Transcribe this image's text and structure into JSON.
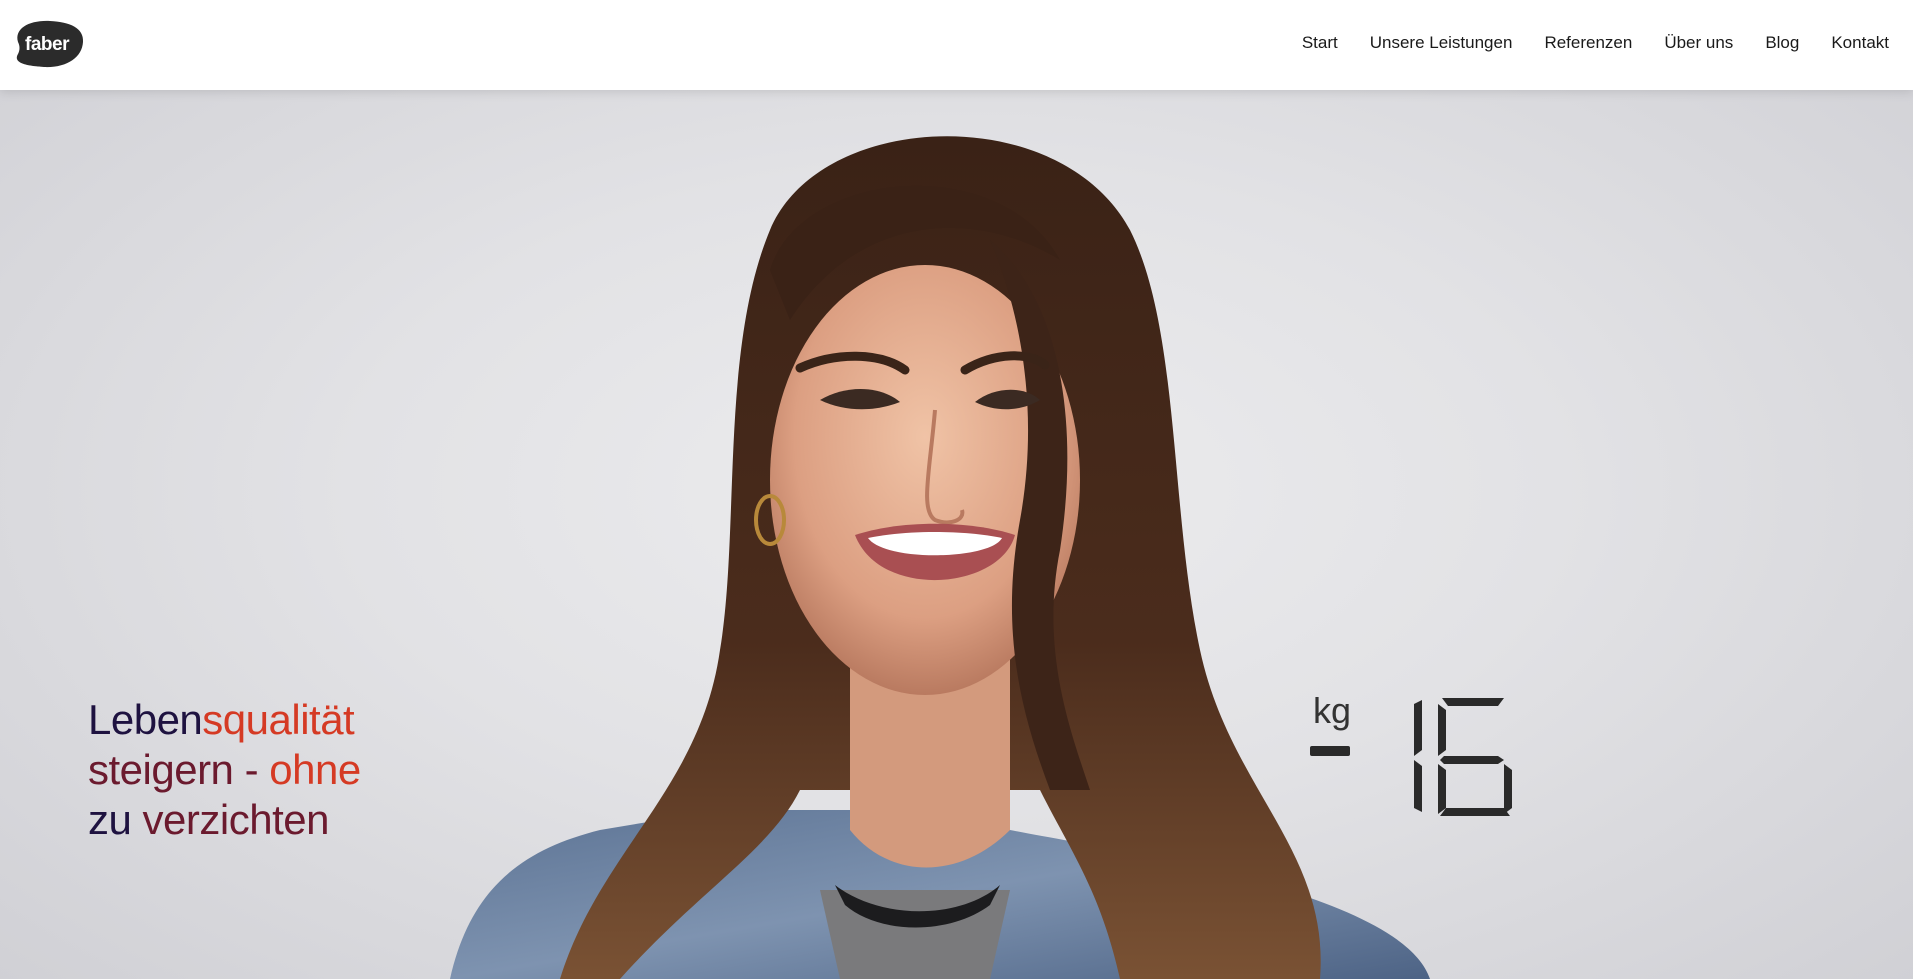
{
  "header": {
    "logo_text": "faber",
    "nav": [
      {
        "label": "Start"
      },
      {
        "label": "Unsere Leistungen"
      },
      {
        "label": "Referenzen"
      },
      {
        "label": "Über uns"
      },
      {
        "label": "Blog"
      },
      {
        "label": "Kontakt"
      }
    ]
  },
  "hero": {
    "headline": {
      "line1_a": "Leben",
      "line1_b": "squalität",
      "line2_a": "steigern - ",
      "line2_b": "ohne",
      "line3_a": "zu ",
      "line3_b": "verzichten"
    },
    "weight": {
      "unit": "kg",
      "sign": "-",
      "value": "16"
    }
  },
  "colors": {
    "headline_dark": "#1e1240",
    "headline_mid": "#6b1a2e",
    "headline_red": "#d53a24",
    "logo_bg": "#2b2b2b"
  },
  "icons": {
    "logo": "faber-blob-logo"
  }
}
